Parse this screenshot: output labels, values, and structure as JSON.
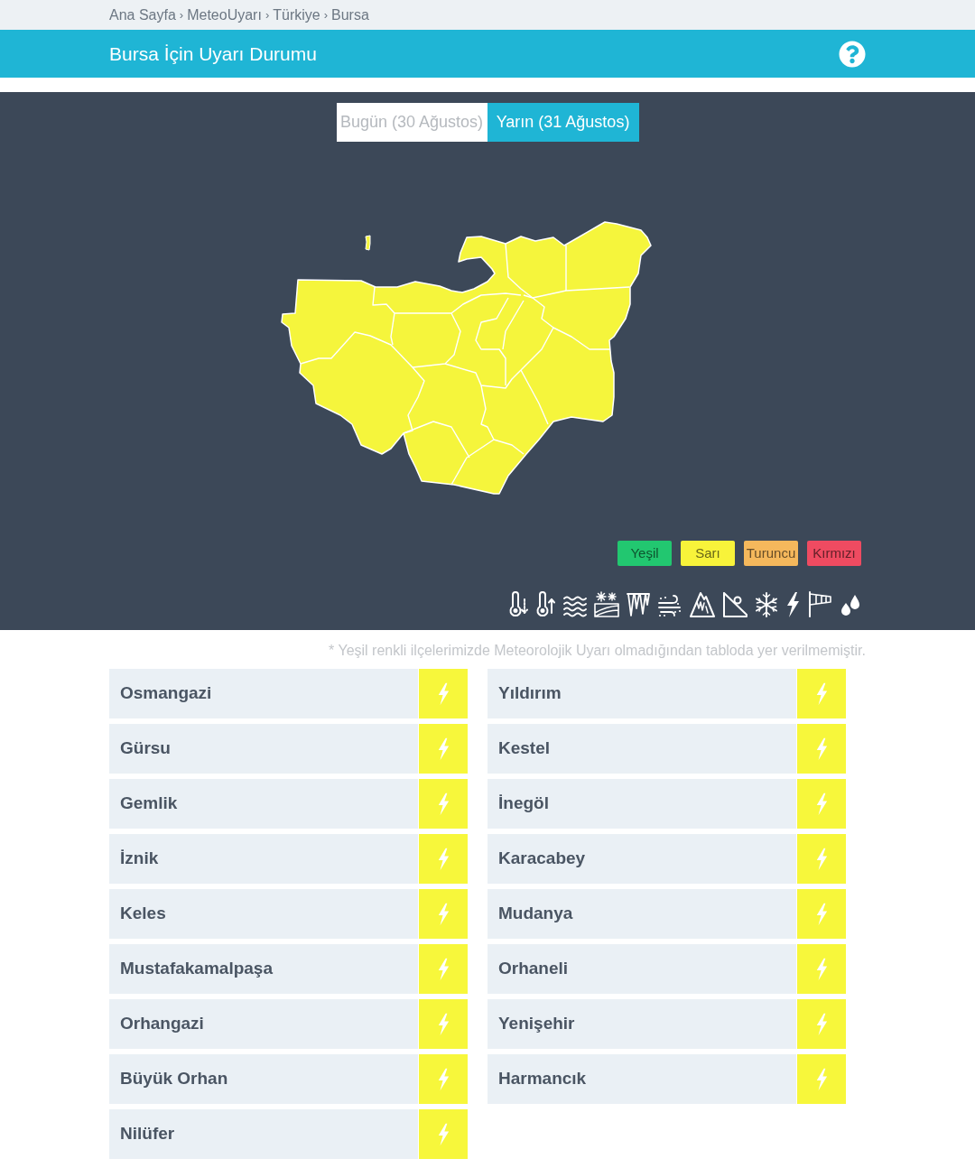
{
  "breadcrumb": [
    {
      "label": "Ana Sayfa"
    },
    {
      "separator": "›",
      "label": "MeteoUyarı"
    },
    {
      "separator": "›",
      "label": "Türkiye"
    },
    {
      "separator": "›",
      "label": "Bursa"
    }
  ],
  "header": {
    "title": "Bursa İçin Uyarı Durumu"
  },
  "tabs": [
    {
      "label": "Bugün (30 Ağustos)",
      "selected": false
    },
    {
      "label": "Yarın (31 Ağustos)",
      "selected": true
    }
  ],
  "legend": [
    {
      "label": "Yeşil",
      "color": "#22c770"
    },
    {
      "label": "Sarı",
      "color": "#f8f33a"
    },
    {
      "label": "Turuncu",
      "color": "#f5b85c"
    },
    {
      "label": "Kırmızı",
      "color": "#ef4b61"
    }
  ],
  "note": "* Yeşil renkli ilçelerimizde Meteorolojik Uyarı olmadığından tabloda yer verilmemiştir.",
  "district_columns": [
    [
      {
        "name": "Osmangazi",
        "color": "#f7f73b"
      },
      {
        "name": "Gürsu",
        "color": "#f7f73b"
      },
      {
        "name": "Gemlik",
        "color": "#f7f73b"
      },
      {
        "name": "İznik",
        "color": "#f7f73b"
      },
      {
        "name": "Keles",
        "color": "#f7f73b"
      },
      {
        "name": "Mustafakamalpaşa",
        "color": "#f7f73b"
      },
      {
        "name": "Orhangazi",
        "color": "#f7f73b"
      },
      {
        "name": "Büyük Orhan",
        "color": "#f7f73b"
      },
      {
        "name": "Nilüfer",
        "color": "#f7f73b"
      }
    ],
    [
      {
        "name": "Yıldırım",
        "color": "#f7f73b"
      },
      {
        "name": "Kestel",
        "color": "#f7f73b"
      },
      {
        "name": "İnegöl",
        "color": "#f7f73b"
      },
      {
        "name": "Karacabey",
        "color": "#f7f73b"
      },
      {
        "name": "Mudanya",
        "color": "#f7f73b"
      },
      {
        "name": "Orhaneli",
        "color": "#f7f73b"
      },
      {
        "name": "Yenişehir",
        "color": "#f7f73b"
      },
      {
        "name": "Harmancık",
        "color": "#f7f73b"
      }
    ]
  ]
}
